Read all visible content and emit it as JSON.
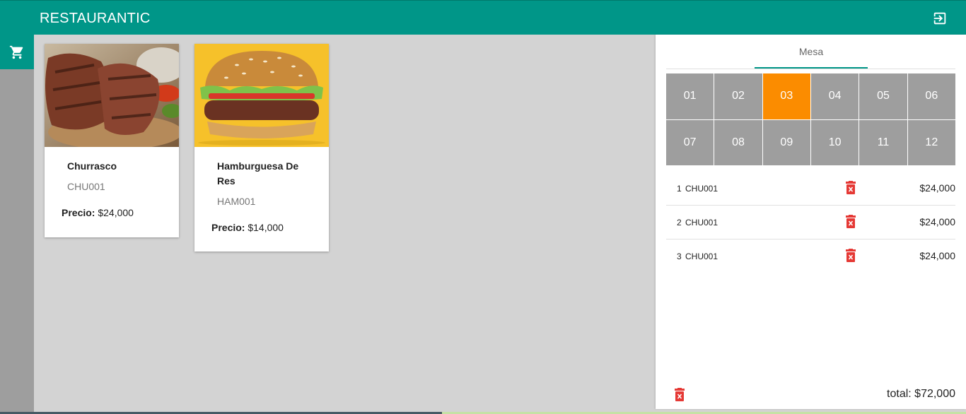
{
  "app": {
    "title": "RESTAURANTIC"
  },
  "colors": {
    "primary": "#009688",
    "active_table": "#fb8c00",
    "table": "#9e9e9e",
    "delete": "#e53935"
  },
  "products": [
    {
      "name": "Churrasco",
      "code": "CHU001",
      "price_label": "Precio:",
      "price": "$24,000",
      "image": "grilled-steak-photo"
    },
    {
      "name": "Hamburguesa De Res",
      "code": "HAM001",
      "price_label": "Precio:",
      "price": "$14,000",
      "image": "beef-burger-photo"
    }
  ],
  "order_panel": {
    "tab": "Mesa",
    "tables": [
      "01",
      "02",
      "03",
      "04",
      "05",
      "06",
      "07",
      "08",
      "09",
      "10",
      "11",
      "12"
    ],
    "selected_table": "03",
    "items": [
      {
        "num": "1",
        "code": "CHU001",
        "price": "$24,000"
      },
      {
        "num": "2",
        "code": "CHU001",
        "price": "$24,000"
      },
      {
        "num": "3",
        "code": "CHU001",
        "price": "$24,000"
      }
    ],
    "total": "total: $72,000"
  },
  "icons": {
    "logout": "logout-icon",
    "cart": "shopping-cart-icon",
    "delete": "delete-icon"
  }
}
